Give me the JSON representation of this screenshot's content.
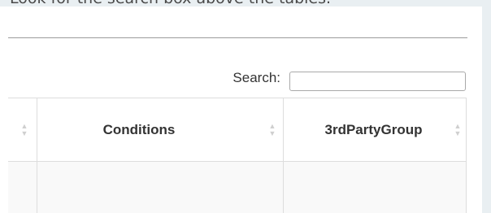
{
  "instruction": {
    "text": "Look for the search box above the tables."
  },
  "search": {
    "label": "Search:",
    "value": "",
    "placeholder": ""
  },
  "table": {
    "columns": [
      {
        "label": "",
        "sort_icon": "sort-both-icon"
      },
      {
        "label": "Conditions",
        "sort_icon": "sort-both-icon"
      },
      {
        "label": "3rdPartyGroup",
        "sort_icon": "sort-both-icon"
      }
    ],
    "rows": [
      [
        "",
        "",
        ""
      ]
    ]
  },
  "colors": {
    "page_background": "#e9eff2",
    "card_background": "#ffffff",
    "row_stripe": "#f9f9f9",
    "border": "#dddddd",
    "sort_icon": "#cfcfcf"
  }
}
